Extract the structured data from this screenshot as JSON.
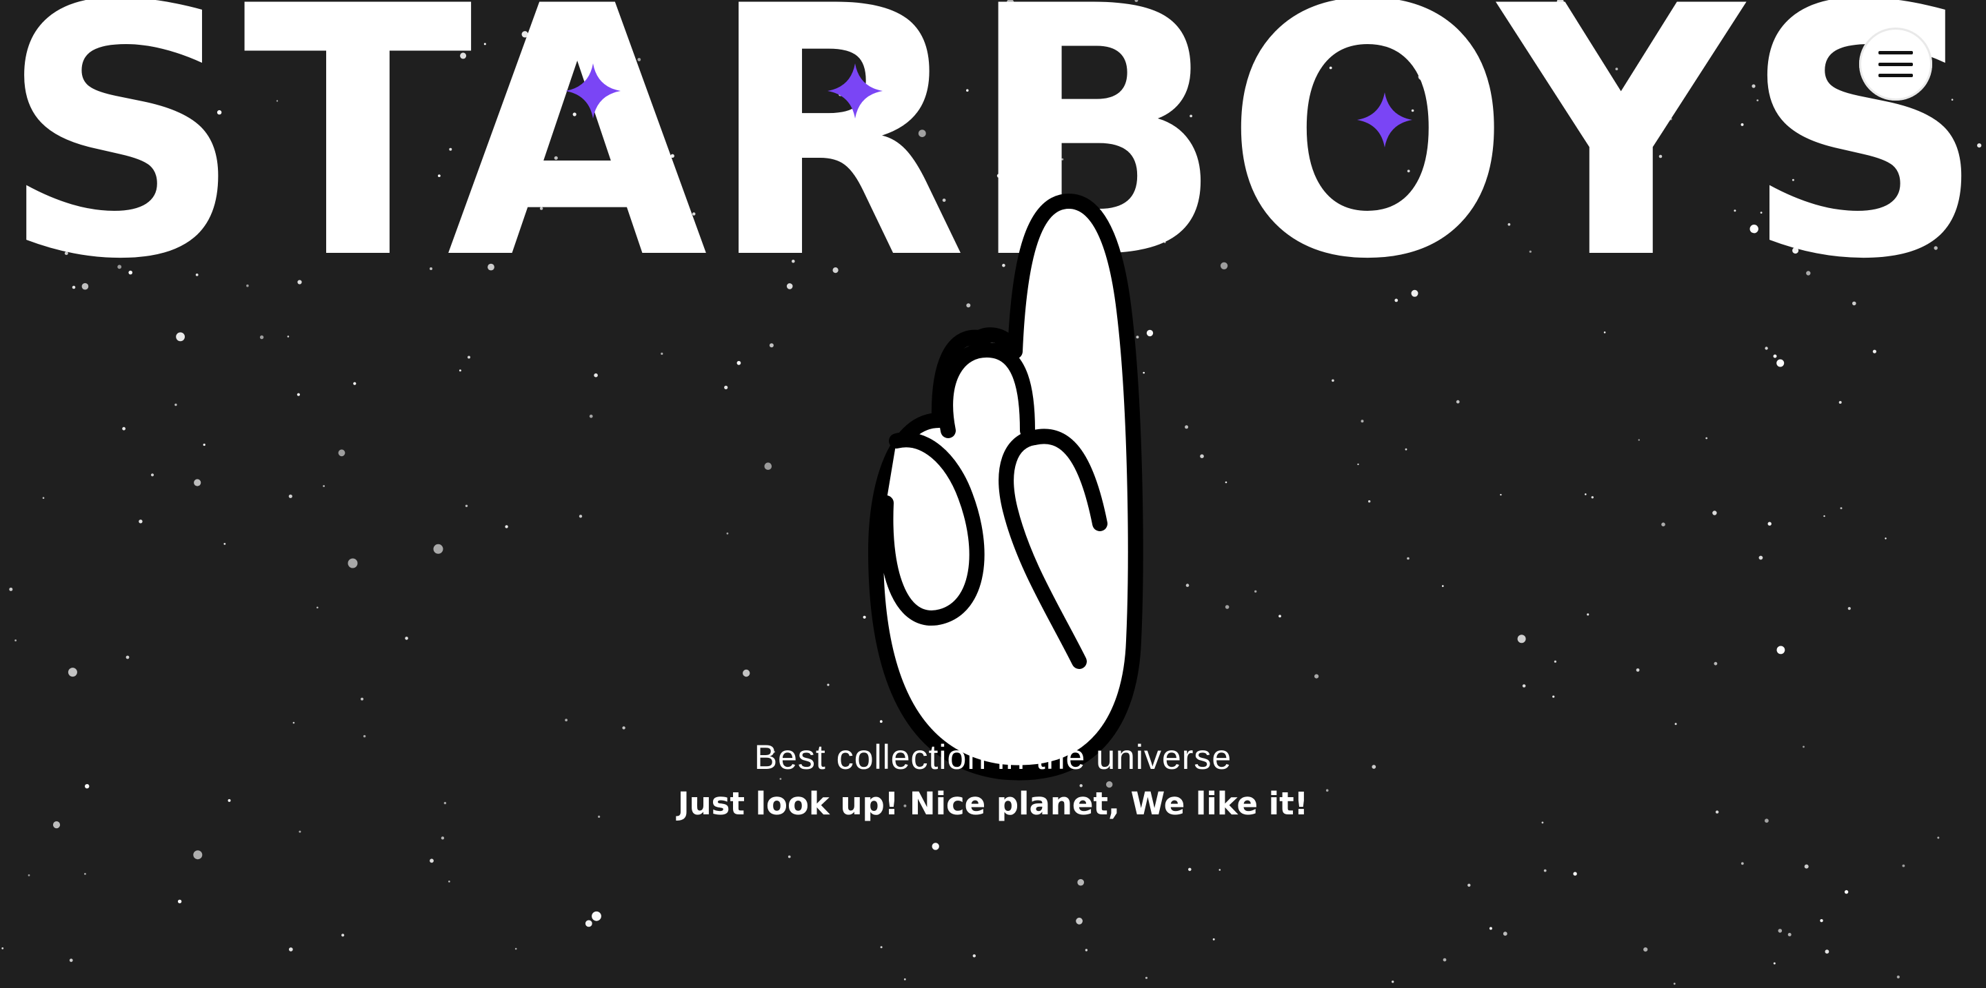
{
  "brand": {
    "wordmark": "STARBOYS",
    "sparkle_color": "#7a45f5"
  },
  "hero": {
    "tagline_line1": "Best collection in the universe",
    "tagline_line2": "Just look up! Nice planet, We like it!"
  },
  "menu": {
    "icon": "hamburger-icon",
    "aria_label": "Menu"
  },
  "colors": {
    "background": "#1f1f1f",
    "foreground": "#ffffff",
    "outline": "#000000",
    "accent": "#7a45f5"
  },
  "illustration": {
    "icon": "pointing-hand-icon"
  }
}
